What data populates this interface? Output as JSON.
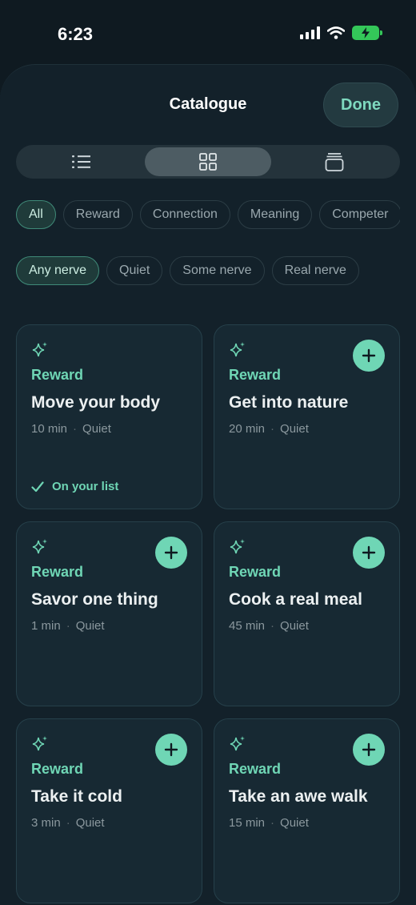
{
  "status": {
    "time": "6:23"
  },
  "header": {
    "title": "Catalogue",
    "done_label": "Done"
  },
  "view_toggle": {
    "items": [
      "list-view",
      "grid-view",
      "stack-view"
    ],
    "selected": "grid-view"
  },
  "category_filters": [
    "All",
    "Reward",
    "Connection",
    "Meaning",
    "Competer"
  ],
  "nerve_filters": [
    "Any nerve",
    "Quiet",
    "Some nerve",
    "Real nerve"
  ],
  "cards": [
    {
      "category": "Reward",
      "name": "Move your body",
      "duration": "10 min",
      "nerve": "Quiet",
      "on_list": true,
      "on_list_label": "On your list"
    },
    {
      "category": "Reward",
      "name": "Get into nature",
      "duration": "20 min",
      "nerve": "Quiet",
      "on_list": false
    },
    {
      "category": "Reward",
      "name": "Savor one thing",
      "duration": "1 min",
      "nerve": "Quiet",
      "on_list": false
    },
    {
      "category": "Reward",
      "name": "Cook a real meal",
      "duration": "45 min",
      "nerve": "Quiet",
      "on_list": false
    },
    {
      "category": "Reward",
      "name": "Take it cold",
      "duration": "3 min",
      "nerve": "Quiet",
      "on_list": false
    },
    {
      "category": "Reward",
      "name": "Take an awe walk",
      "duration": "15 min",
      "nerve": "Quiet",
      "on_list": false
    }
  ],
  "colors": {
    "accent": "#6fd6b5",
    "background": "#13212a",
    "card": "#172933"
  }
}
